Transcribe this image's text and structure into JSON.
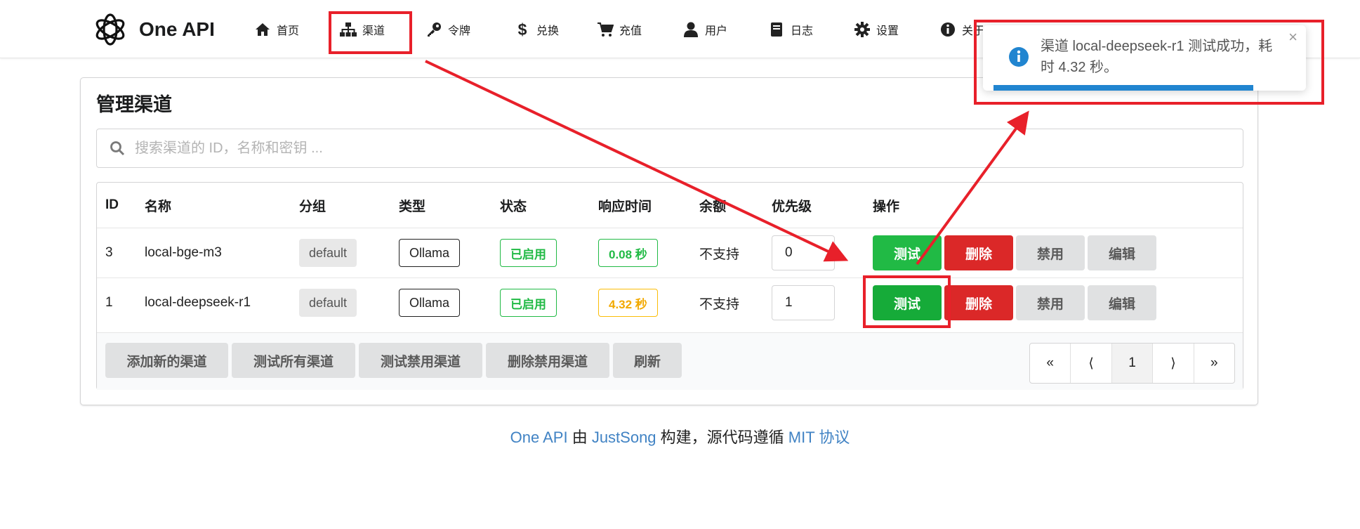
{
  "brand": {
    "name": "One API",
    "logo": "openai-logo-icon"
  },
  "nav": [
    {
      "icon": "home-icon",
      "label": "首页"
    },
    {
      "icon": "sitemap-icon",
      "label": "渠道"
    },
    {
      "icon": "key-icon",
      "label": "令牌"
    },
    {
      "icon": "dollar-icon",
      "label": "兑换"
    },
    {
      "icon": "cart-icon",
      "label": "充值"
    },
    {
      "icon": "user-icon",
      "label": "用户"
    },
    {
      "icon": "book-icon",
      "label": "日志"
    },
    {
      "icon": "gear-icon",
      "label": "设置"
    },
    {
      "icon": "info-circle-icon",
      "label": "关于"
    }
  ],
  "card": {
    "title": "管理渠道",
    "search_placeholder": "搜索渠道的 ID，名称和密钥 ..."
  },
  "table": {
    "headers": [
      "ID",
      "名称",
      "分组",
      "类型",
      "状态",
      "响应时间",
      "余额",
      "优先级",
      "操作"
    ],
    "rows": [
      {
        "id": "3",
        "name": "local-bge-m3",
        "group": "default",
        "type": "Ollama",
        "status": "已启用",
        "response_time": "0.08 秒",
        "balance": "不支持",
        "priority": "0"
      },
      {
        "id": "1",
        "name": "local-deepseek-r1",
        "group": "default",
        "type": "Ollama",
        "status": "已启用",
        "response_time": "4.32 秒",
        "balance": "不支持",
        "priority": "1"
      }
    ],
    "actions": {
      "test": "测试",
      "delete": "删除",
      "disable": "禁用",
      "edit": "编辑"
    },
    "footer_buttons": [
      "添加新的渠道",
      "测试所有渠道",
      "测试禁用渠道",
      "删除禁用渠道",
      "刷新"
    ],
    "pagination": {
      "first": "«",
      "prev": "⟨",
      "current": "1",
      "next": "⟩",
      "last": "»"
    }
  },
  "site_footer": {
    "part1": "One API",
    "part2": " 由 ",
    "part3": "JustSong",
    "part4": " 构建，源代码遵循 ",
    "part5": "MIT 协议"
  },
  "toast": {
    "message": "渠道 local-deepseek-r1 测试成功，耗时 4.32 秒。",
    "close": "×",
    "progress": 0.86
  },
  "colors": {
    "green": "#21ba45",
    "red": "#db2828",
    "blue": "#2185d0",
    "annotation": "#e8202a"
  }
}
